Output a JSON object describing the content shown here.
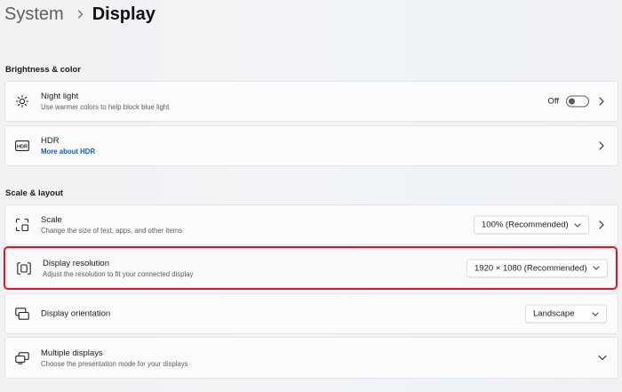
{
  "breadcrumb": {
    "parent": "System",
    "current": "Display"
  },
  "sections": {
    "brightness": "Brightness & color",
    "scale_layout": "Scale & layout"
  },
  "night_light": {
    "title": "Night light",
    "description": "Use warmer colors to help block blue light",
    "toggle_state": "Off",
    "icon": "brightness-sun-icon"
  },
  "hdr": {
    "title": "HDR",
    "link": "More about HDR",
    "icon": "hdr-icon"
  },
  "scale": {
    "title": "Scale",
    "description": "Change the size of text, apps, and other items",
    "value": "100% (Recommended)",
    "icon": "scale-icon"
  },
  "resolution": {
    "title": "Display resolution",
    "description": "Adjust the resolution to fit your connected display",
    "value": "1920 × 1080 (Recommended)",
    "icon": "resolution-icon",
    "highlight_color": "#cc1f27"
  },
  "orientation": {
    "title": "Display orientation",
    "value": "Landscape",
    "icon": "orientation-icon"
  },
  "multiple_displays": {
    "title": "Multiple displays",
    "description": "Choose the presentation mode for your displays",
    "icon": "multiple-displays-icon"
  },
  "colors": {
    "link": "#1f5aa6",
    "highlight": "#cc1f27"
  }
}
